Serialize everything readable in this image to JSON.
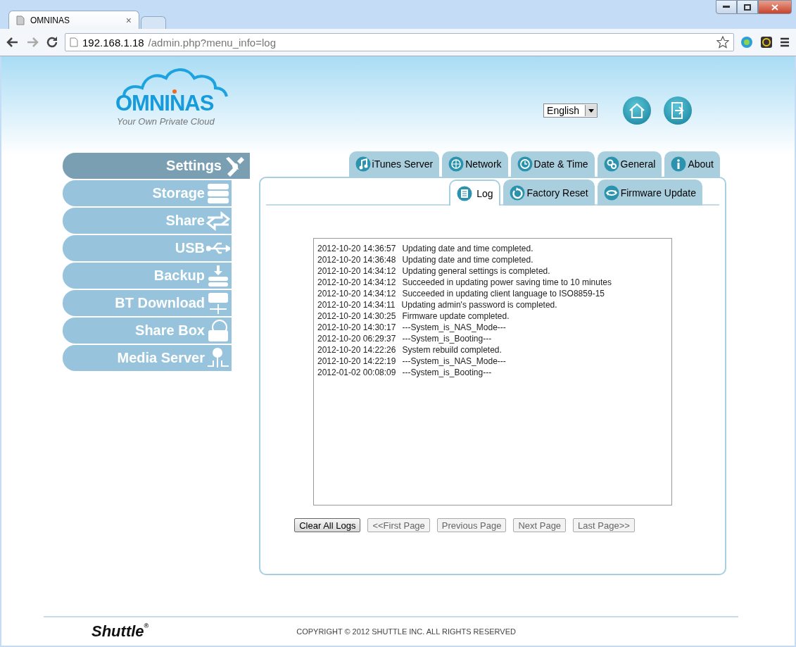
{
  "browser": {
    "tabs": [
      {
        "title": "OMNINAS",
        "close": "×",
        "selected": true
      },
      {
        "selected": false
      }
    ],
    "url": {
      "host": "192.168.1.18",
      "path": "/admin.php?menu_info=log"
    }
  },
  "header": {
    "logo": "OMNINAS",
    "tagline": "Your Own Private Cloud",
    "language": "English"
  },
  "sidebar": {
    "items": [
      {
        "label": "Settings",
        "selected": true
      },
      {
        "label": "Storage",
        "selected": false
      },
      {
        "label": "Share",
        "selected": false
      },
      {
        "label": "USB",
        "selected": false
      },
      {
        "label": "Backup",
        "selected": false
      },
      {
        "label": "BT Download",
        "selected": false
      },
      {
        "label": "Share Box",
        "selected": false
      },
      {
        "label": "Media Server",
        "selected": false
      }
    ]
  },
  "tabs": [
    {
      "label": "iTunes Server",
      "selected": false
    },
    {
      "label": "Network",
      "selected": false
    },
    {
      "label": "Date & Time",
      "selected": false
    },
    {
      "label": "General",
      "selected": false
    },
    {
      "label": "About",
      "selected": false
    }
  ],
  "subtabs": [
    {
      "label": "Log",
      "selected": true
    },
    {
      "label": "Factory Reset",
      "selected": false
    },
    {
      "label": "Firmware Update",
      "selected": false
    }
  ],
  "log": [
    {
      "time": "2012-10-20 14:36:57",
      "message": "Updating date and time completed."
    },
    {
      "time": "2012-10-20 14:36:48",
      "message": "Updating date and time completed."
    },
    {
      "time": "2012-10-20 14:34:12",
      "message": "Updating general settings is completed."
    },
    {
      "time": "2012-10-20 14:34:12",
      "message": "Succeeded in updating power saving time to 10 minutes"
    },
    {
      "time": "2012-10-20 14:34:12",
      "message": "Succeeded in updating client language to ISO8859-15"
    },
    {
      "time": "2012-10-20 14:34:11",
      "message": "Updating admin's password is completed."
    },
    {
      "time": "2012-10-20 14:30:25",
      "message": "Firmware update completed."
    },
    {
      "time": "2012-10-20 14:30:17",
      "message": "---System_is_NAS_Mode---"
    },
    {
      "time": "2012-10-20 06:29:37",
      "message": "---System_is_Booting---"
    },
    {
      "time": "2012-10-20 14:22:26",
      "message": "System rebuild completed."
    },
    {
      "time": "2012-10-20 14:22:19",
      "message": "---System_is_NAS_Mode---"
    },
    {
      "time": "2012-01-02 00:08:09",
      "message": "---System_is_Booting---"
    }
  ],
  "buttons": [
    {
      "label": "Clear All Logs",
      "disabled": false
    },
    {
      "label": "<<First Page",
      "disabled": true
    },
    {
      "label": "Previous Page",
      "disabled": true
    },
    {
      "label": "Next Page",
      "disabled": true
    },
    {
      "label": "Last Page>>",
      "disabled": true
    }
  ],
  "footer": {
    "brand": "Shuttle",
    "registered": "®",
    "copyright": "COPYRIGHT © 2012 SHUTTLE INC. ALL RIGHTS RESERVED"
  }
}
